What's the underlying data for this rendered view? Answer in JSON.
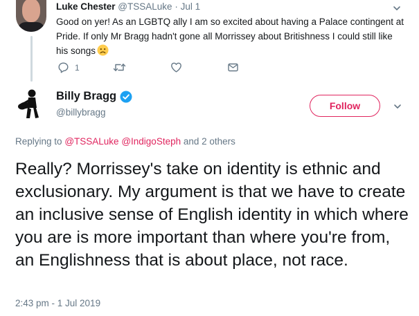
{
  "parent_tweet": {
    "author_name": "Luke Chester",
    "author_handle": "@TSSALuke",
    "separator": "·",
    "date": "Jul 1",
    "text": "Good on yer! As an LGBTQ ally I am so excited about having a Palace contingent at Pride. If only Mr Bragg hadn't gone all Morrissey about Britishness I could still like his songs",
    "emoji_icon": "sad-face-emoji",
    "actions": {
      "reply_count": "1",
      "reply_icon": "reply-icon",
      "retweet_icon": "retweet-icon",
      "like_icon": "heart-icon",
      "dm_icon": "envelope-icon"
    }
  },
  "main_tweet": {
    "author_name": "Billy Bragg",
    "author_handle": "@billybragg",
    "verified_icon": "verified-badge-icon",
    "follow_label": "Follow",
    "replying_prefix": "Replying to",
    "replying_mentions": [
      "@TSSALuke",
      "@IndigoSteph"
    ],
    "replying_suffix": "and 2 others",
    "text": "Really? Morrissey's take on identity is ethnic and exclusionary. My argument is that we have to create an inclusive sense of English identity in which where you are is more important than where you're from, an Englishness that is about place, not race.",
    "timestamp": "2:43 pm - 1 Jul 2019"
  },
  "colors": {
    "accent": "#e0245e",
    "verified": "#1da1f2",
    "muted": "#657786",
    "text": "#14171a"
  }
}
